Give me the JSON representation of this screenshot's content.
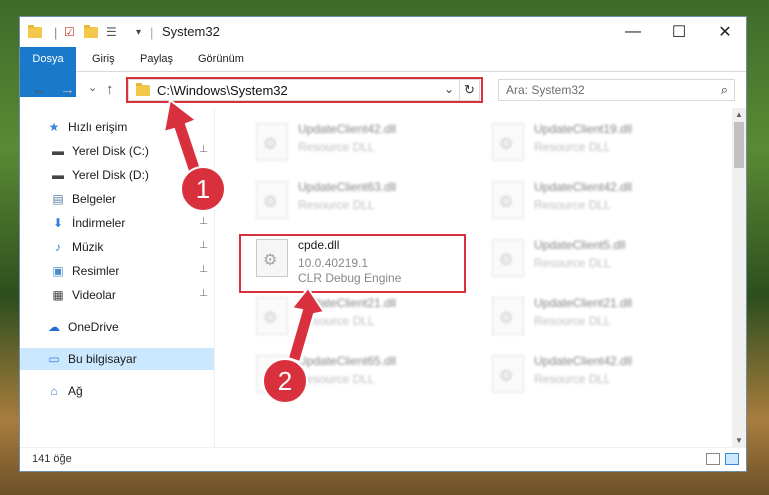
{
  "window": {
    "title": "System32",
    "controls": {
      "minimize": "—",
      "maximize": "☐",
      "close": "✕"
    }
  },
  "ribbon": {
    "tabs": [
      "Dosya",
      "Giriş",
      "Paylaş",
      "Görünüm"
    ]
  },
  "nav": {
    "back": "←",
    "forward": "→",
    "recent": "⌄",
    "up": "↑",
    "address": "C:\\Windows\\System32",
    "address_dropdown": "⌄",
    "refresh": "↻",
    "search_placeholder": "Ara: System32",
    "search_icon": "⌕"
  },
  "sidebar": {
    "items": [
      {
        "label": "Hızlı erişim",
        "icon": "star-icon",
        "glyph": "★",
        "color": "#3a86d6",
        "pinned": false
      },
      {
        "label": "Yerel Disk (C:)",
        "icon": "drive-icon",
        "glyph": "▬",
        "color": "#444",
        "pinned": true
      },
      {
        "label": "Yerel Disk (D:)",
        "icon": "drive-icon",
        "glyph": "▬",
        "color": "#444",
        "pinned": true
      },
      {
        "label": "Belgeler",
        "icon": "documents-icon",
        "glyph": "▤",
        "color": "#5c7fa8",
        "pinned": true
      },
      {
        "label": "İndirmeler",
        "icon": "download-icon",
        "glyph": "⬇",
        "color": "#2f7fd6",
        "pinned": true
      },
      {
        "label": "Müzik",
        "icon": "music-icon",
        "glyph": "♪",
        "color": "#2f7fd6",
        "pinned": true
      },
      {
        "label": "Resimler",
        "icon": "pictures-icon",
        "glyph": "▣",
        "color": "#4a8cc9",
        "pinned": true
      },
      {
        "label": "Videolar",
        "icon": "videos-icon",
        "glyph": "▦",
        "color": "#444",
        "pinned": true
      },
      {
        "label": "OneDrive",
        "icon": "cloud-icon",
        "glyph": "☁",
        "color": "#1f6ed4",
        "pinned": false
      },
      {
        "label": "Bu bilgisayar",
        "icon": "computer-icon",
        "glyph": "▭",
        "color": "#2f7fd6",
        "pinned": false
      },
      {
        "label": "Ağ",
        "icon": "network-icon",
        "glyph": "⌂",
        "color": "#2f7fd6",
        "pinned": false
      }
    ],
    "pin_glyph": "📌"
  },
  "files": [
    {
      "name": "UpdateClient42.dll",
      "line2": "Resource DLL",
      "line3": "",
      "blurred": true
    },
    {
      "name": "UpdateClient19.dll",
      "line2": "Resource DLL",
      "line3": "",
      "blurred": true
    },
    {
      "name": "UpdateClient63.dll",
      "line2": "Resource DLL",
      "line3": "",
      "blurred": true
    },
    {
      "name": "UpdateClient42.dll",
      "line2": "Resource DLL",
      "line3": "",
      "blurred": true
    },
    {
      "name": "cpde.dll",
      "line2": "10.0.40219.1",
      "line3": "CLR Debug Engine",
      "blurred": false
    },
    {
      "name": "UpdateClient5.dll",
      "line2": "Resource DLL",
      "line3": "",
      "blurred": true
    },
    {
      "name": "UpdateClient21.dll",
      "line2": "Resource DLL",
      "line3": "",
      "blurred": true
    },
    {
      "name": "UpdateClient21.dll",
      "line2": "Resource DLL",
      "line3": "",
      "blurred": true
    },
    {
      "name": "UpdateClient65.dll",
      "line2": "Resource DLL",
      "line3": "",
      "blurred": true
    },
    {
      "name": "UpdateClient42.dll",
      "line2": "Resource DLL",
      "line3": "",
      "blurred": true
    }
  ],
  "status": {
    "count": "141 öğe"
  },
  "callouts": [
    "1",
    "2"
  ],
  "colors": {
    "accent": "#1979ca",
    "highlight": "#d9303d",
    "selected": "#cce8ff"
  }
}
